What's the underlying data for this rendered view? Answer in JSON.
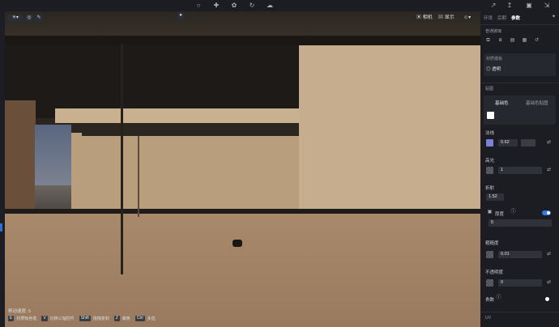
{
  "topbar": {
    "center_icons": [
      "bulb-icon",
      "bone-icon",
      "leaf-icon",
      "refresh-icon",
      "cloud-icon"
    ],
    "right_icons": [
      "share-icon",
      "export-icon",
      "image-icon",
      "collapse-icon"
    ]
  },
  "viewport": {
    "camera_label": "相机",
    "display_label": "显示",
    "status_speed": "移动速度: 5",
    "hints": [
      {
        "key": "E",
        "text": "材质吸色笔"
      },
      {
        "key": "V",
        "text": "切换三轴控件"
      },
      {
        "key": "Shift",
        "text": "拖拽复制"
      },
      {
        "key": "Z",
        "text": "聚焦"
      },
      {
        "key": "Ctrl",
        "text": "多选"
      }
    ]
  },
  "panel": {
    "tabs": [
      "环境",
      "后期",
      "参数"
    ],
    "active_tab": "参数",
    "section_general": "普通玻璃",
    "section_template_label": "材质模板",
    "template_value": "透明",
    "section_maps": "贴图",
    "basecolor_tab": "基础色",
    "basecolor_map_tab": "基础色贴图",
    "normal_label": "法线",
    "normal_value": "0.62",
    "specular_label": "高光",
    "specular_value": "1",
    "refraction_label": "折射",
    "refraction_value": "1.52",
    "thickness_label": "厚度",
    "thickness_value": "5",
    "roughness_label": "粗糙度",
    "roughness_value": "0.01",
    "opacity_label": "不透明度",
    "opacity_value": "0",
    "glossy_label": "贵数",
    "uv_label": "UV",
    "colors": {
      "accent": "#2d7fe8",
      "normal_swatch": "#7b7fd6",
      "base_swatch": "#ffffff"
    }
  }
}
